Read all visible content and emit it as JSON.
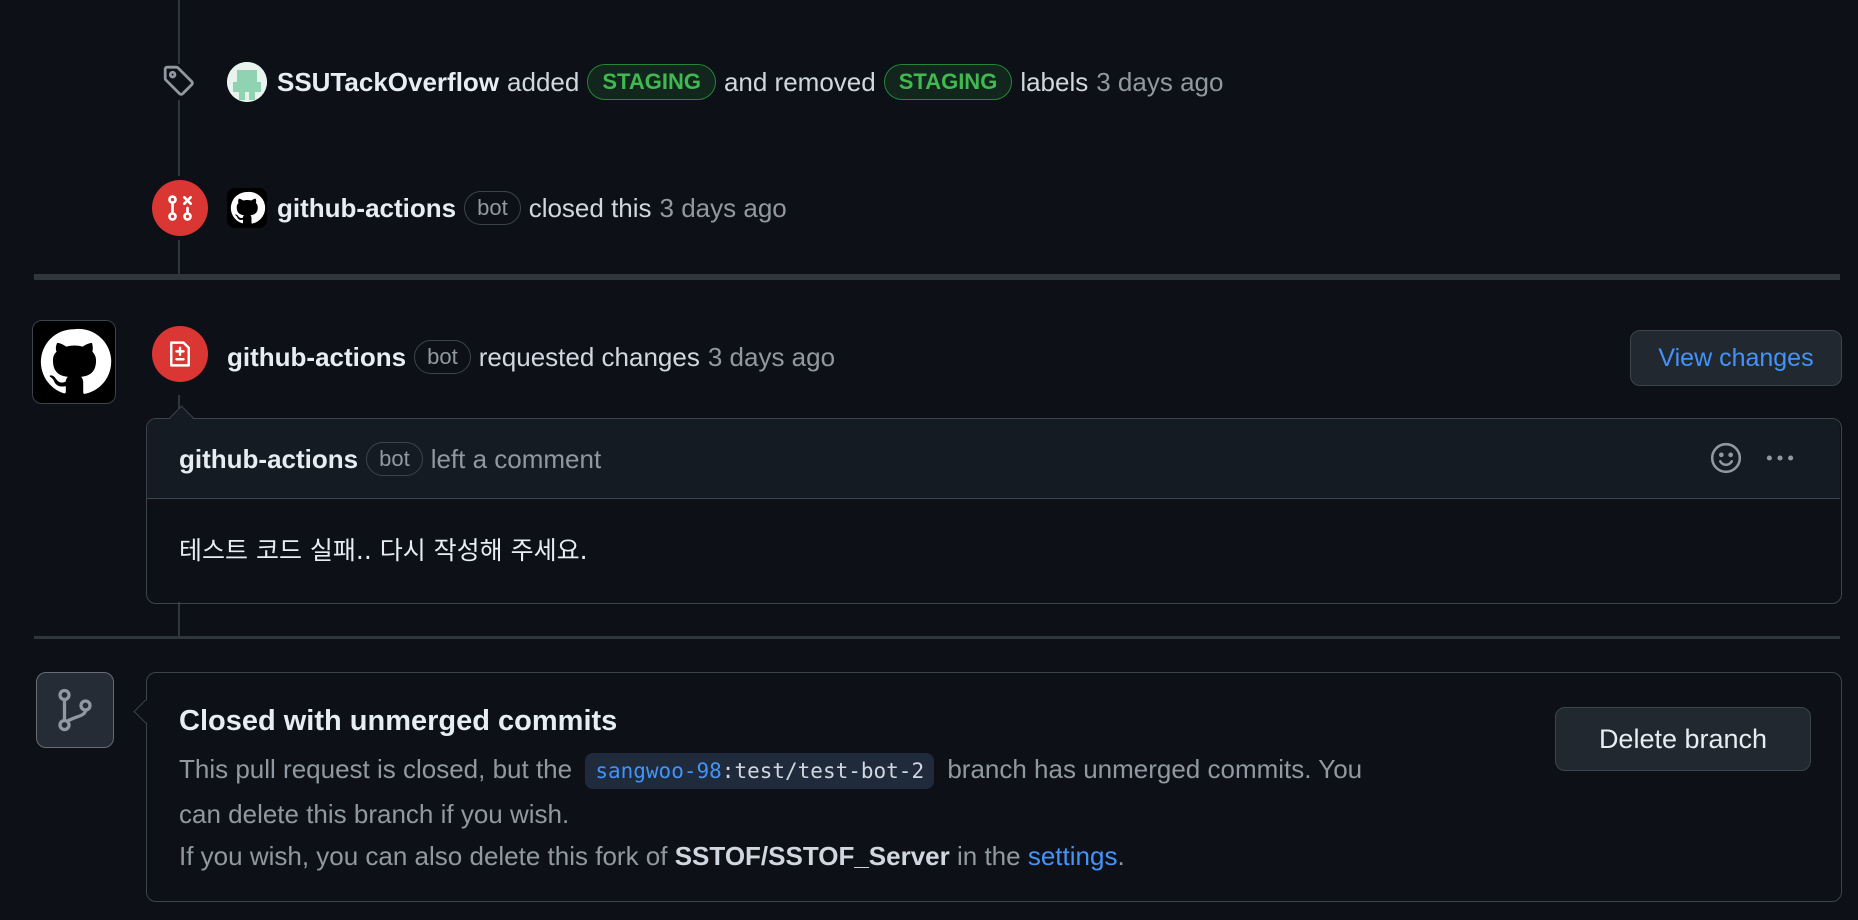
{
  "event_label": {
    "actor": "SSUTackOverflow",
    "added_text": "added",
    "added_label": "STAGING",
    "removed_text": "and removed",
    "removed_label": "STAGING",
    "suffix": "labels",
    "time": "3 days ago",
    "icon": "tag-icon"
  },
  "event_closed": {
    "actor": "github-actions",
    "bot": "bot",
    "action": "closed this",
    "time": "3 days ago",
    "icon": "git-pull-request-closed-icon"
  },
  "review": {
    "actor": "github-actions",
    "bot": "bot",
    "action": "requested changes",
    "time": "3 days ago",
    "view_button": "View changes",
    "icon": "file-diff-icon",
    "comment": {
      "author": "github-actions",
      "bot": "bot",
      "action": "left a comment",
      "body": "테스트 코드 실패.. 다시 작성해 주세요.",
      "emoji_icon": "smiley-icon",
      "more_icon": "kebab-horizontal-icon"
    }
  },
  "closed_box": {
    "icon": "git-branch-icon",
    "title": "Closed with unmerged commits",
    "line1_before": "This pull request is closed, but the",
    "branch_owner": "sangwoo-98",
    "branch_sep": ":",
    "branch_name": "test/test-bot-2",
    "line1_after": "branch has unmerged commits. You",
    "line2": "can delete this branch if you wish.",
    "line3_before": "If you wish, you can also delete this fork of",
    "repo": "SSTOF/SSTOF_Server",
    "line3_mid": "in the",
    "settings_link": "settings",
    "line3_end": ".",
    "delete_button": "Delete branch"
  },
  "colors": {
    "background": "#0d1117",
    "label_green": "#3fb950",
    "closed_red": "#da3633",
    "link_blue": "#4493f8"
  }
}
